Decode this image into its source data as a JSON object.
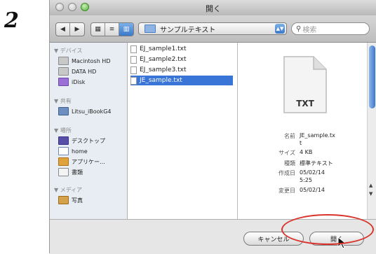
{
  "step_number": "2",
  "window": {
    "title": "開く"
  },
  "toolbar": {
    "back": "◀",
    "forward": "▶",
    "view_icon": "▦",
    "view_list": "≡",
    "view_columns": "▥",
    "location": "サンプルテキスト",
    "search_placeholder": "検索"
  },
  "sidebar": {
    "devices_header": "▼ デバイス",
    "devices": [
      "Macintosh HD",
      "DATA HD",
      "iDisk"
    ],
    "shared_header": "▼ 共有",
    "shared": [
      "Litsu_iBookG4"
    ],
    "places_header": "▼ 場所",
    "places": [
      "デスクトップ",
      "home",
      "アプリケー…",
      "書類"
    ],
    "media_header": "▼ メディア",
    "media": [
      "写真"
    ]
  },
  "files": [
    {
      "name": "EJ_sample1.txt",
      "selected": false
    },
    {
      "name": "EJ_sample2.txt",
      "selected": false
    },
    {
      "name": "EJ_sample3.txt",
      "selected": false
    },
    {
      "name": "JE_sample.txt",
      "selected": true
    }
  ],
  "preview": {
    "type_label": "TXT",
    "name_label": "名前",
    "name_value_1": "JE_sample.tx",
    "name_value_2": "t",
    "size_label": "サイズ",
    "size_value": "4 KB",
    "kind_label": "種類",
    "kind_value": "標準テキスト",
    "created_label": "作成日",
    "created_value_1": "05/02/14",
    "created_value_2": "5:25",
    "modified_label": "変更日",
    "modified_value": "05/02/14"
  },
  "buttons": {
    "cancel": "キャンセル",
    "open": "開く"
  },
  "colors": {
    "selection": "#3875d7",
    "highlight_ring": "#d9332b"
  }
}
